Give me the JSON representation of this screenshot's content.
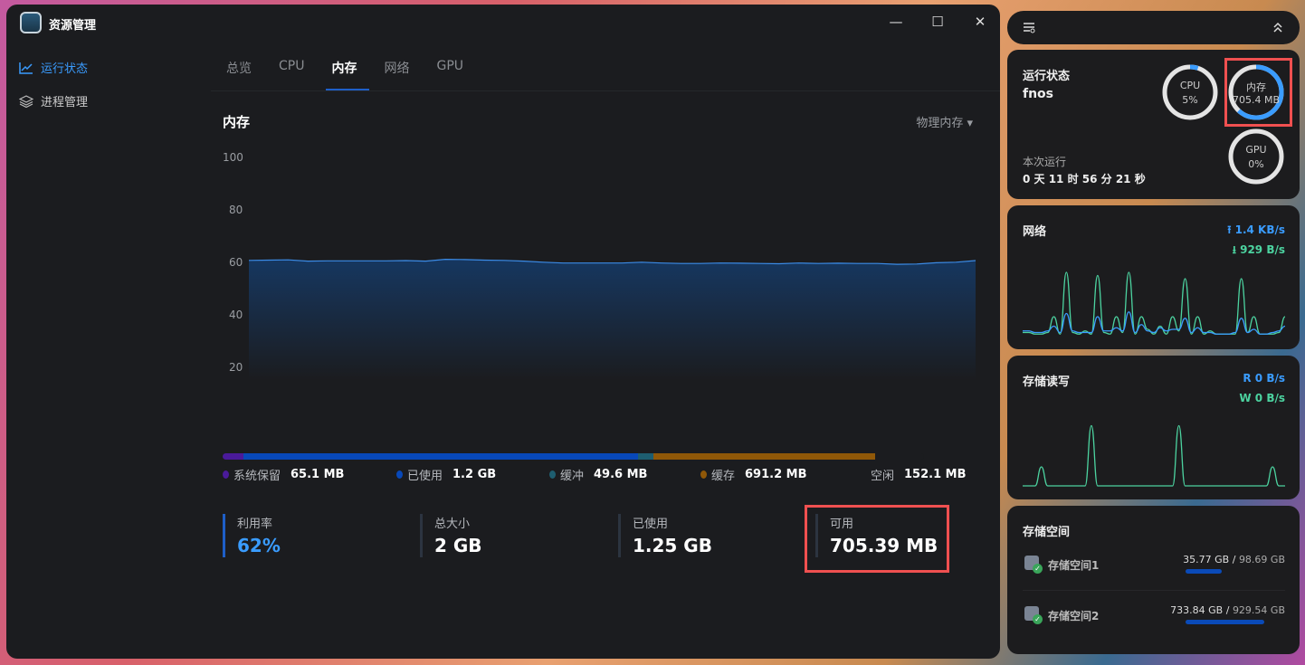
{
  "window": {
    "title": "资源管理",
    "minimize": "—",
    "maximize": "☐",
    "close": "✕"
  },
  "sidebar": {
    "items": [
      {
        "label": "运行状态",
        "icon": "line-chart-icon",
        "active": true
      },
      {
        "label": "进程管理",
        "icon": "layers-icon",
        "active": false
      }
    ]
  },
  "tabs": [
    {
      "label": "总览"
    },
    {
      "label": "CPU"
    },
    {
      "label": "内存",
      "active": true
    },
    {
      "label": "网络"
    },
    {
      "label": "GPU"
    }
  ],
  "memory": {
    "title": "内存",
    "selector": "物理内存",
    "chart_data": {
      "type": "area",
      "ylim": [
        0,
        100
      ],
      "yticks": [
        "100",
        "80",
        "60",
        "40",
        "20"
      ],
      "grid": false,
      "color": "#3b8be6",
      "values": [
        62.5,
        62.6,
        62.7,
        62.2,
        62.3,
        62.3,
        62.3,
        62.3,
        62.4,
        62.2,
        62.9,
        62.8,
        62.6,
        62.5,
        62.2,
        61.8,
        61.5,
        61.5,
        61.5,
        61.5,
        61.8,
        61.5,
        61.3,
        61.3,
        61.5,
        61.4,
        61.3,
        61.2,
        61.5,
        61.3,
        61.4,
        61.3,
        61.3,
        61.0,
        61.1,
        61.6,
        61.8,
        62.4
      ]
    },
    "breakdown": [
      {
        "label": "系统保留",
        "value": "65.1 MB",
        "mb": 65.1,
        "color": "#4a1a9a"
      },
      {
        "label": "已使用",
        "value": "1.2 GB",
        "mb": 1229,
        "color": "#0848b8"
      },
      {
        "label": "缓冲",
        "value": "49.6 MB",
        "mb": 49.6,
        "color": "#1e5e70"
      },
      {
        "label": "缓存",
        "value": "691.2 MB",
        "mb": 691.2,
        "color": "#905808"
      },
      {
        "label": "空闲",
        "value": "152.1 MB",
        "mb": 152.1,
        "color": "#1b1c1f"
      }
    ],
    "stats": [
      {
        "label": "利用率",
        "value": "62%",
        "accent": "#3a9cff"
      },
      {
        "label": "总大小",
        "value": "2 GB"
      },
      {
        "label": "已使用",
        "value": "1.25 GB"
      },
      {
        "label": "可用",
        "value": "705.39 MB",
        "highlighted": true
      }
    ]
  },
  "widget": {
    "status": {
      "title": "运行状态",
      "host": "fnos",
      "uptime_label": "本次运行",
      "uptime": "0 天 11 时 56 分 21 秒",
      "rings": [
        {
          "label": "CPU",
          "value": "5%",
          "fraction": 0.05
        },
        {
          "label": "内存",
          "value": "705.4 MB",
          "fraction": 0.62,
          "highlighted": true
        },
        {
          "label": "GPU",
          "value": "0%",
          "fraction": 0
        }
      ]
    },
    "network": {
      "title": "网络",
      "upload": "1.4 KB/s",
      "download": "929 B/s",
      "up_color": "#3a9cff",
      "down_color": "#4cd3a0",
      "down_series": [
        2,
        2,
        1,
        1,
        2,
        12,
        1,
        40,
        2,
        1,
        3,
        1,
        38,
        2,
        1,
        12,
        2,
        40,
        1,
        12,
        4,
        1,
        6,
        1,
        12,
        3,
        36,
        1,
        12,
        1,
        3,
        1,
        1,
        1,
        1,
        36,
        2,
        12,
        1,
        1,
        1,
        2,
        12
      ],
      "up_series": [
        3,
        3,
        2,
        2,
        3,
        6,
        2,
        14,
        3,
        2,
        2,
        2,
        12,
        3,
        3,
        5,
        3,
        15,
        2,
        7,
        3,
        2,
        5,
        3,
        4,
        4,
        11,
        2,
        5,
        2,
        2,
        1,
        1,
        1,
        2,
        11,
        2,
        4,
        1,
        1,
        2,
        3,
        6
      ]
    },
    "disk": {
      "title": "存储读写",
      "read": "R 0 B/s",
      "write": "W 0 B/s",
      "write_series": [
        0,
        0,
        0,
        12,
        0,
        0,
        0,
        0,
        0,
        0,
        0,
        38,
        0,
        0,
        0,
        0,
        0,
        0,
        0,
        0,
        0,
        0,
        0,
        0,
        0,
        38,
        0,
        0,
        0,
        0,
        0,
        0,
        0,
        0,
        0,
        0,
        0,
        0,
        0,
        0,
        12,
        0,
        0
      ]
    },
    "storage": {
      "title": "存储空间",
      "items": [
        {
          "name": "存储空间1",
          "used": "35.77 GB",
          "total": "98.69 GB",
          "fraction": 0.362
        },
        {
          "name": "存储空间2",
          "used": "733.84 GB",
          "total": "929.54 GB",
          "fraction": 0.79
        }
      ]
    }
  }
}
